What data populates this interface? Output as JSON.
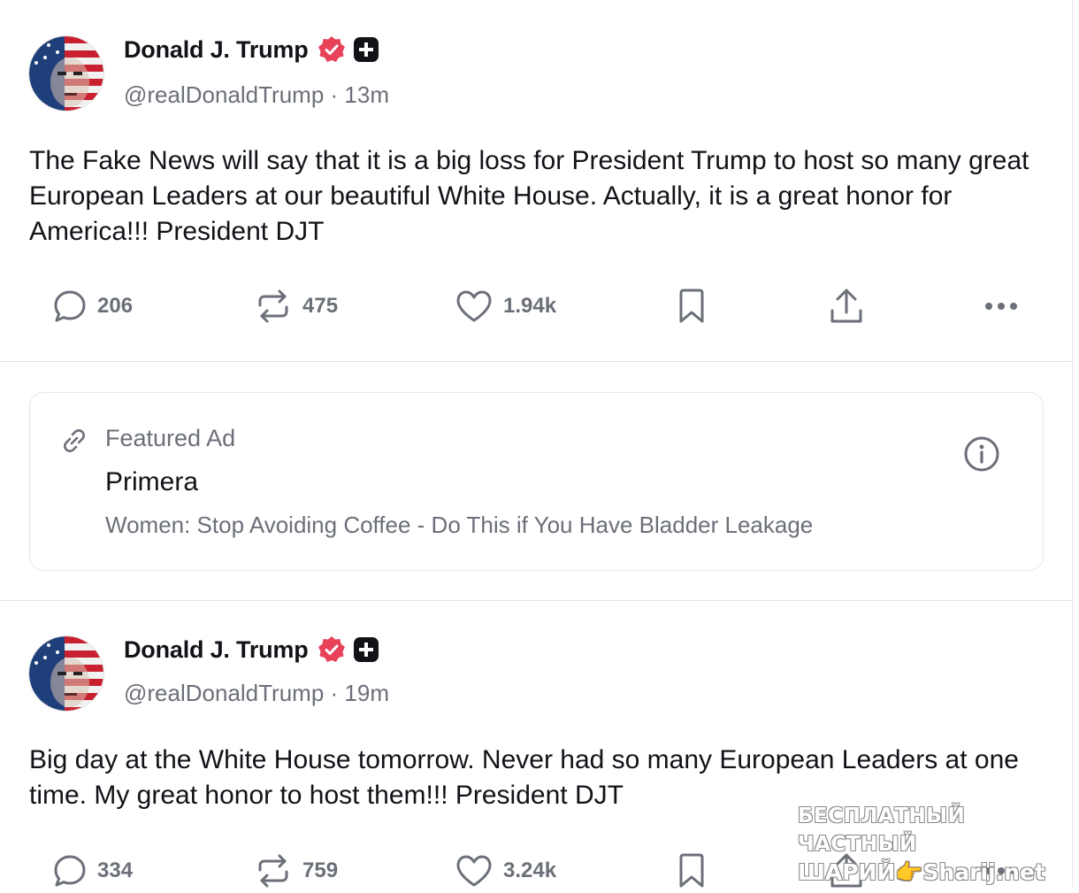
{
  "posts": [
    {
      "author": "Donald J. Trump",
      "handle": "@realDonaldTrump",
      "time": "· 13m",
      "text": "The Fake News will say that it is a big loss for President Trump to host so many great European Leaders at our beautiful White House. Actually, it is a great honor for America!!! President DJT",
      "replies": "206",
      "reposts": "475",
      "likes": "1.94k"
    },
    {
      "author": "Donald J. Trump",
      "handle": "@realDonaldTrump",
      "time": "· 19m",
      "text": "Big day at the White House tomorrow. Never had so many European Leaders at one time. My great honor to host them!!! President DJT",
      "replies": "334",
      "reposts": "759",
      "likes": "3.24k"
    }
  ],
  "ad": {
    "label": "Featured Ad",
    "title": "Primera",
    "description": "Women: Stop Avoiding Coffee - Do This if You Have Bladder Leakage"
  },
  "watermark": {
    "line1": "БЕСПЛАТНЫЙ ЧАСТНЫЙ",
    "line2": "ШАРИЙ👉Sharij.net"
  },
  "icons": {
    "reply": "speech-bubble-icon",
    "repost": "repost-arrows-icon",
    "like": "heart-icon",
    "bookmark": "bookmark-icon",
    "share": "share-upload-icon",
    "more": "more-dots-icon",
    "verified": "verified-badge-icon",
    "plus": "plus-square-icon",
    "link": "link-icon",
    "info": "info-circle-icon"
  },
  "colors": {
    "verified": "#e8425a",
    "muted": "#6b6f78",
    "text": "#111318"
  }
}
